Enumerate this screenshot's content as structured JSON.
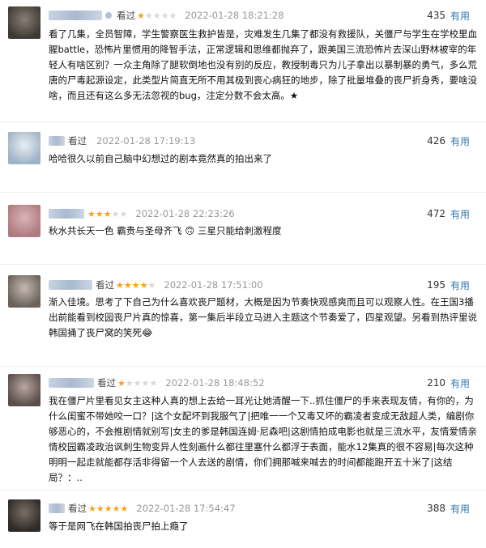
{
  "useful_label": "有用",
  "comments": [
    {
      "status": "看过",
      "rating": 1,
      "time": "2022-01-28 18:21:28",
      "votes": "435",
      "text": "看了几集，全员智障，学生警察医生救护皆是，灾难发生几集了都没有救援队，关僵尸与学生在学校里血腥battle，恐怖片里惯用的降智手法，正常逻辑和思维都抛弃了，跟美国三流恐怖片去深山野林被宰的年轻人有啥区别？一众主角除了腿软倒地也没有别的反应，教授制毒只为儿子拿出以暴制暴的勇气，多么荒唐的尸毒起源设定，此类型片简直无所不用其极到丧心病狂的地步，除了批量堆叠的丧尸折身秀，要啥没啥，而且还有这么多无法忽视的bug，注定分数不会太高。★",
      "avatar_colors": [
        "#3d3a36",
        "#8a7f72"
      ]
    },
    {
      "status": "看过",
      "rating": 0,
      "time": "2022-01-28 17:19:13",
      "votes": "426",
      "text": "哈哈很久以前自己脑中幻想过的剧本竟然真的拍出来了",
      "avatar_colors": [
        "#9fb3c6",
        "#e8eef4"
      ]
    },
    {
      "status": "",
      "rating": 3,
      "time": "2022-01-28 22:23:26",
      "votes": "472",
      "text": "秋水共长天一色 霸贵与圣母齐飞 🙃 三星只能给刺激程度",
      "avatar_colors": [
        "#b07a80",
        "#d9b4b8"
      ]
    },
    {
      "status": "看过",
      "rating": 4,
      "time": "2022-01-28 17:51:00",
      "votes": "195",
      "text": "渐入佳境。思考了下自己为什么喜欢丧尸题材，大概是因为节奏快观感爽而且可以观察人性。在王国3播出前能看到校园丧尸片真的惊喜，第一集后半段立马进入主题这个节奏爱了，四星观望。另看到热评里说韩国捅了丧尸窝的笑死😂",
      "avatar_colors": [
        "#6b625c",
        "#c4b9b0"
      ]
    },
    {
      "status": "看过",
      "rating": 1,
      "time": "2022-01-28 18:48:52",
      "votes": "210",
      "text": "我在僵尸片里看见女主这种人真的想上去给一耳光让她清醒一下..抓住僵尸的手来表现友情，有你的，为什么闺蜜不带她咬一口？|这个女配坏到我服气了|把唯一一个又毒又坏的霸凌者变成无敌超人类，编剧你够恶心的，不会推剧情就别写|女主的爹是韩国连姆·尼森吧|这剧情拍成电影也就是三流水平，友情爱情亲情校园霸凌政治讽刺生物变异人性刻画什么都往里塞什么都浮于表面，能水12集真的很不容易|每次这种明明一起走就能都存活非得留一个人去送的剧情，你们拥那喊来喊去的时间都能跑开五十米了|这结局？：..",
      "avatar_colors": [
        "#5a4d4a",
        "#b9a6a0"
      ]
    },
    {
      "status": "看过",
      "rating": 5,
      "time": "2022-01-28 17:54:47",
      "votes": "388",
      "text": "等于是网飞在韩国拍丧尸拍上瘾了",
      "avatar_colors": [
        "#2e2a28",
        "#7a6e66"
      ]
    }
  ]
}
